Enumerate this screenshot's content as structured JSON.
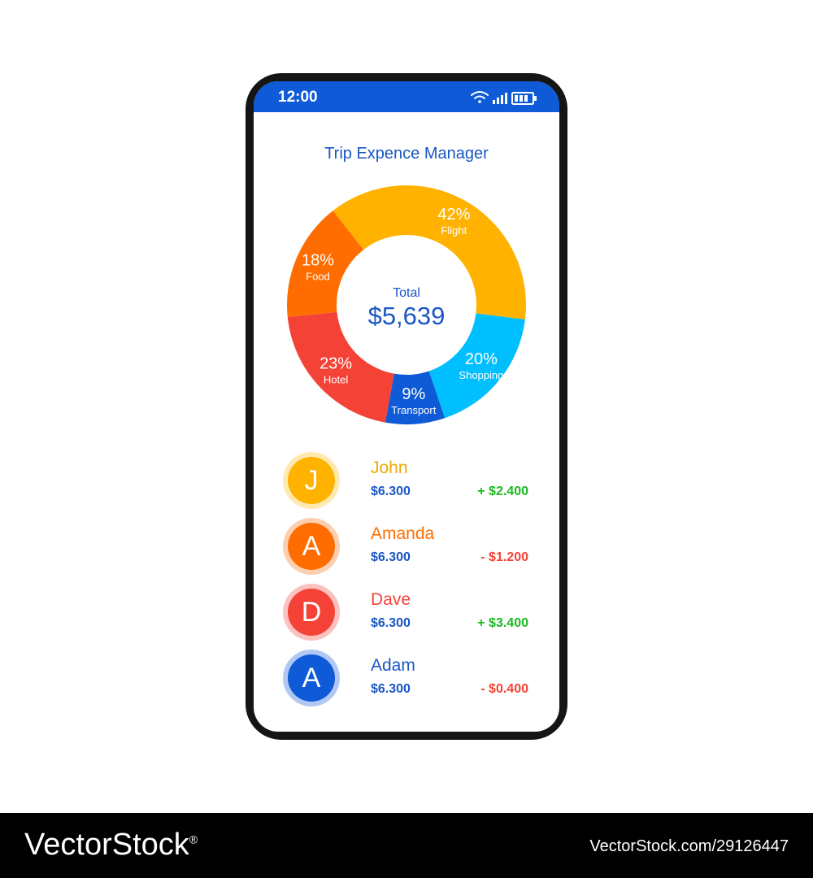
{
  "status_bar": {
    "time": "12:00"
  },
  "app": {
    "title": "Trip Expence Manager"
  },
  "chart_data": {
    "type": "donut",
    "center_label": "Total",
    "center_value": "$5,639",
    "slices": [
      {
        "label": "Flight",
        "percent": 42,
        "percent_text": "42%",
        "color": "#ffb300"
      },
      {
        "label": "Shopping",
        "percent": 20,
        "percent_text": "20%",
        "color": "#00bfff"
      },
      {
        "label": "Transport",
        "percent": 9,
        "percent_text": "9%",
        "color": "#0f5ad6"
      },
      {
        "label": "Hotel",
        "percent": 23,
        "percent_text": "23%",
        "color": "#f44336"
      },
      {
        "label": "Food",
        "percent": 18,
        "percent_text": "18%",
        "color": "#ff6d00"
      }
    ]
  },
  "people": [
    {
      "initial": "J",
      "name": "John",
      "paid": "$6.300",
      "balance": "+ $2.400",
      "color": "#ffb300",
      "ring": "#ffe9b0",
      "name_color": "#f0a800",
      "balance_color": "#19b91e"
    },
    {
      "initial": "A",
      "name": "Amanda",
      "paid": "$6.300",
      "balance": "- $1.200",
      "color": "#ff6d00",
      "ring": "#fbcfb0",
      "name_color": "#ff6d00",
      "balance_color": "#f44336"
    },
    {
      "initial": "D",
      "name": "Dave",
      "paid": "$6.300",
      "balance": "+ $3.400",
      "color": "#f44336",
      "ring": "#fbc2c0",
      "name_color": "#f44336",
      "balance_color": "#19b91e"
    },
    {
      "initial": "A",
      "name": "Adam",
      "paid": "$6.300",
      "balance": "- $0.400",
      "color": "#0f5ad6",
      "ring": "#b0c8f4",
      "name_color": "#1a56c4",
      "balance_color": "#f44336"
    }
  ],
  "watermark": {
    "brand": "VectorStock",
    "reg": "®",
    "id": "VectorStock.com/29126447"
  }
}
